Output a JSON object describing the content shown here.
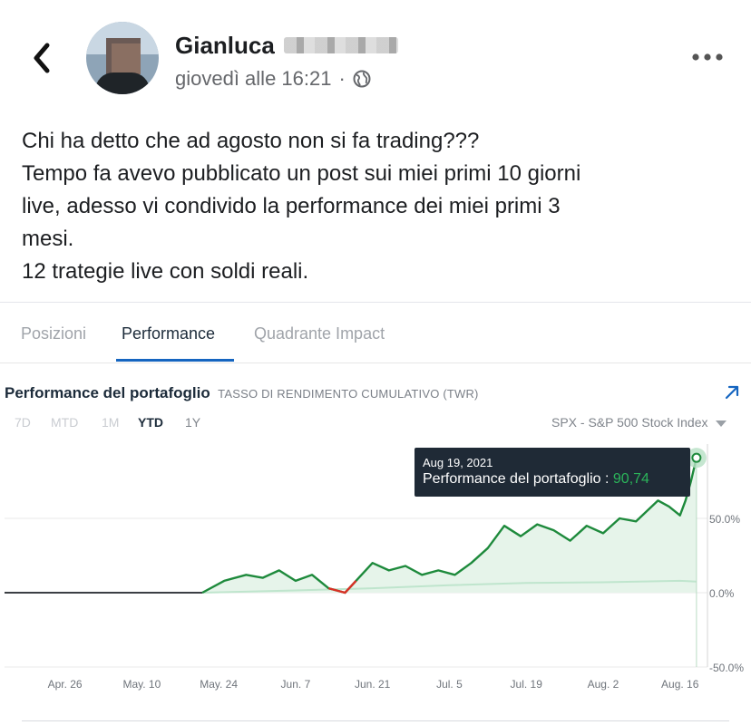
{
  "post": {
    "author_first_name": "Gianluca",
    "timestamp": "giovedì alle 16:21",
    "separator": "·",
    "audience_icon": "globe-icon",
    "text_lines": [
      "Chi ha detto che ad agosto non si fa trading???",
      "Tempo fa avevo pubblicato un post sui miei primi 10 giorni",
      "live, adesso vi condivido la performance dei miei primi 3",
      "mesi.",
      "12 trategie live con soldi reali."
    ]
  },
  "tabs": [
    {
      "label": "Posizioni",
      "active": false
    },
    {
      "label": "Performance",
      "active": true
    },
    {
      "label": "Quadrante Impact",
      "active": false
    }
  ],
  "panel": {
    "title": "Performance del portafoglio",
    "subtitle": "TASSO DI RENDIMENTO CUMULATIVO (TWR)",
    "ranges": [
      "7D",
      "MTD",
      "1M",
      "YTD",
      "1Y"
    ],
    "active_range": "YTD",
    "benchmark": "SPX - S&P 500 Stock Index"
  },
  "tooltip": {
    "date": "Aug 19, 2021",
    "label": "Performance del portafoglio :",
    "value": "90,74"
  },
  "colors": {
    "portfolio_line": "#1e8a3c",
    "portfolio_fill": "#e6f4ea",
    "benchmark_line": "#bfe5cd",
    "negative_segment": "#d93025",
    "accent": "#1565c0"
  },
  "chart_data": {
    "type": "area",
    "x_tick_labels": [
      "Apr. 26",
      "May. 10",
      "May. 24",
      "Jun. 7",
      "Jun. 21",
      "Jul. 5",
      "Jul. 19",
      "Aug. 2",
      "Aug. 16"
    ],
    "y_tick_labels": [
      "50.0%",
      "0.0%",
      "-50.0%"
    ],
    "ylim": [
      -50,
      100
    ],
    "grid": true,
    "series": [
      {
        "name": "Performance del portafoglio",
        "x": [
          "2021-04-15",
          "2021-05-21",
          "2021-05-25",
          "2021-05-29",
          "2021-06-01",
          "2021-06-04",
          "2021-06-07",
          "2021-06-10",
          "2021-06-13",
          "2021-06-16",
          "2021-06-18",
          "2021-06-21",
          "2021-06-24",
          "2021-06-27",
          "2021-06-30",
          "2021-07-03",
          "2021-07-06",
          "2021-07-09",
          "2021-07-12",
          "2021-07-15",
          "2021-07-18",
          "2021-07-21",
          "2021-07-24",
          "2021-07-27",
          "2021-07-30",
          "2021-08-02",
          "2021-08-05",
          "2021-08-08",
          "2021-08-10",
          "2021-08-12",
          "2021-08-14",
          "2021-08-16",
          "2021-08-17",
          "2021-08-18",
          "2021-08-19"
        ],
        "values": [
          0,
          0,
          8,
          12,
          10,
          15,
          8,
          12,
          3,
          0,
          8,
          20,
          15,
          18,
          12,
          15,
          12,
          20,
          30,
          45,
          38,
          46,
          42,
          35,
          45,
          40,
          50,
          48,
          55,
          62,
          58,
          52,
          62,
          75,
          90.74
        ]
      },
      {
        "name": "SPX - S&P 500 Stock Index",
        "x": [
          "2021-04-15",
          "2021-05-21",
          "2021-06-07",
          "2021-06-21",
          "2021-07-05",
          "2021-07-19",
          "2021-08-02",
          "2021-08-16",
          "2021-08-19"
        ],
        "values": [
          0,
          0,
          1.5,
          3,
          5,
          6.5,
          7,
          8,
          7.5
        ]
      }
    ]
  }
}
